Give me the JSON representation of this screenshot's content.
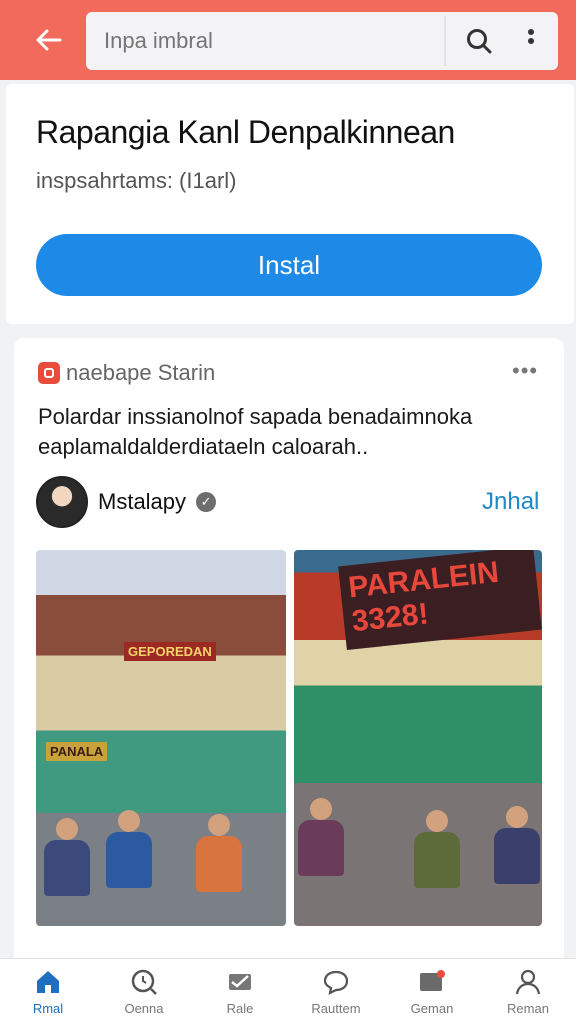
{
  "header": {
    "search_placeholder": "Inpa imbral",
    "back_icon": "back-arrow-icon",
    "search_icon": "search-icon",
    "more_icon": "more-vertical-icon",
    "color": "#f16a5c"
  },
  "app": {
    "title": "Rapangia Kanl Denpalkinnean",
    "subtitle": "inspsahrtams: (I1arl)",
    "install_label": "Instal",
    "accent": "#1c8ae6"
  },
  "post": {
    "source": "naebape Starin",
    "menu": "•••",
    "text": "Polardar inssianolnof sapada benadaimnoka eaplamaldalderdiataeln caloarah..",
    "author": "Mstalapy",
    "verified": "✓",
    "follow_label": "Jnhal",
    "photo1_signs": [
      "GEPOREDAN",
      "PANALA"
    ],
    "photo2_sign": "PARALEIN 3328!"
  },
  "nav": {
    "items": [
      {
        "label": "Rmal",
        "icon": "home-icon",
        "active": true
      },
      {
        "label": "Oenna",
        "icon": "discover-icon",
        "active": false
      },
      {
        "label": "Rale",
        "icon": "mail-icon",
        "active": false
      },
      {
        "label": "Rauttem",
        "icon": "chat-icon",
        "active": false
      },
      {
        "label": "Geman",
        "icon": "inbox-icon",
        "active": false
      },
      {
        "label": "Reman",
        "icon": "profile-icon",
        "active": false
      }
    ]
  }
}
